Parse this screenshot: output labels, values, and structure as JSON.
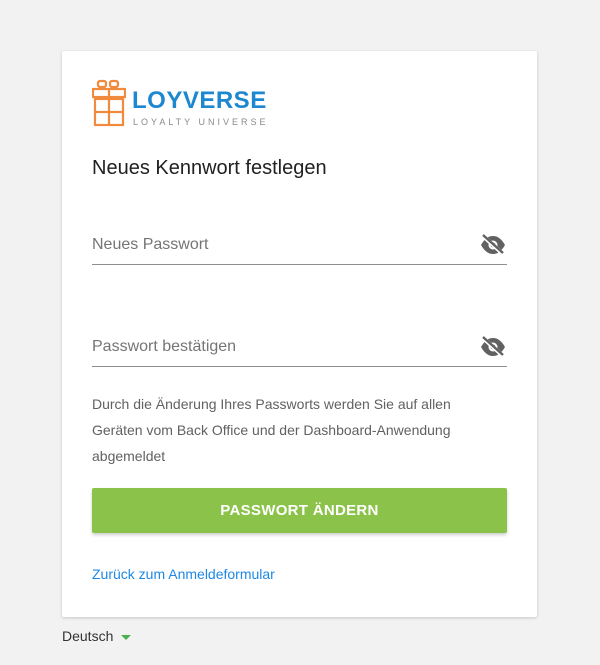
{
  "brand": {
    "name": "LOYVERSE",
    "tagline": "LOYALTY UNIVERSE",
    "logo_icon": "gift-box-icon",
    "colors": {
      "wordmark": "#1d87d0",
      "icon": "#f08a3c"
    }
  },
  "form": {
    "title": "Neues Kennwort festlegen",
    "new_password": {
      "placeholder": "Neues Passwort",
      "value": "",
      "toggle_icon": "eye-off-icon"
    },
    "confirm_password": {
      "placeholder": "Passwort bestätigen",
      "value": "",
      "toggle_icon": "eye-off-icon"
    },
    "note": "Durch die Änderung Ihres Passworts werden Sie auf allen Geräten vom Back Office und der Dashboard-Anwendung abgemeldet",
    "submit_label": "PASSWORT ÄNDERN",
    "back_link": "Zurück zum Anmeldeformular"
  },
  "footer": {
    "language": "Deutsch"
  },
  "colors": {
    "primary_button": "#8bc34a",
    "link": "#1e88e5",
    "background": "#f2f2f2"
  }
}
